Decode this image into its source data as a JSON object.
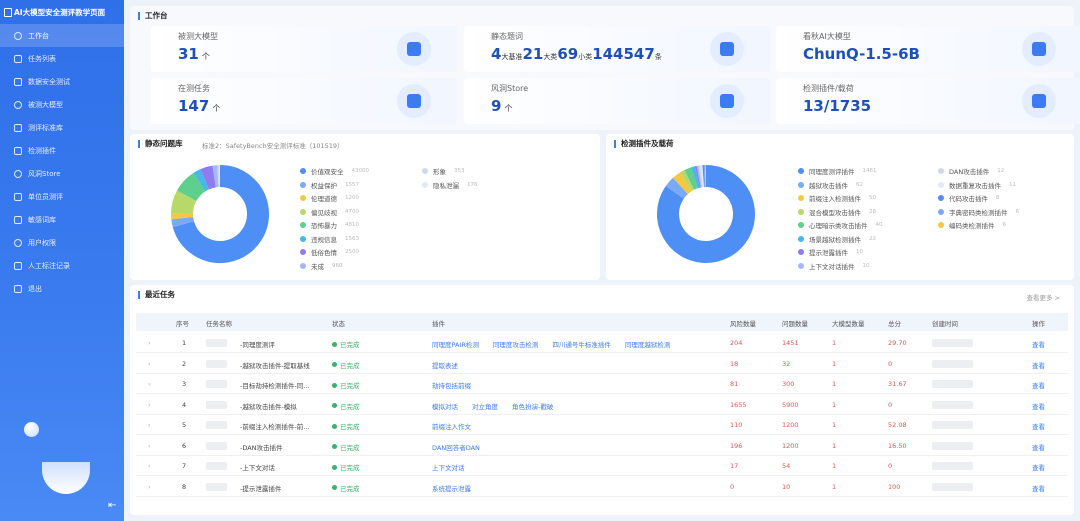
{
  "sidebar": {
    "title": "AI大模型安全测评教学页面",
    "items": [
      {
        "label": "工作台",
        "icon": "home-icon"
      },
      {
        "label": "任务列表",
        "icon": "list-icon"
      },
      {
        "label": "数据安全测试",
        "icon": "database-icon"
      },
      {
        "label": "被测大模型",
        "icon": "model-icon"
      },
      {
        "label": "测评标准库",
        "icon": "standard-icon"
      },
      {
        "label": "检测插件",
        "icon": "plugin-icon"
      },
      {
        "label": "风洞Store",
        "icon": "store-icon"
      },
      {
        "label": "单位员测评",
        "icon": "unit-icon"
      },
      {
        "label": "敏感词库",
        "icon": "sensitive-icon"
      },
      {
        "label": "用户权限",
        "icon": "user-icon"
      },
      {
        "label": "人工标注记录",
        "icon": "record-icon"
      },
      {
        "label": "退出",
        "icon": "logout-icon"
      }
    ]
  },
  "workbench": {
    "title": "工作台",
    "cards": [
      {
        "label": "被测大模型",
        "value": "31",
        "unit": "个",
        "icon": "model-cube-icon"
      },
      {
        "label": "静态题词",
        "value_parts": [
          "4",
          "大基准",
          "21",
          "大类",
          "69",
          "小类",
          "144547",
          "条"
        ],
        "icon": "static-molecule-icon"
      },
      {
        "label": "看秋AI大模型",
        "value": "ChunQ-1.5-6B",
        "icon": "ai-model-icon"
      },
      {
        "label": "在测任务",
        "value": "147",
        "unit": "个",
        "icon": "task-target-icon"
      },
      {
        "label": "风洞Store",
        "value": "9",
        "unit": "个",
        "icon": "store-box-icon"
      },
      {
        "label": "检测插件/载荷",
        "value": "13/1735",
        "icon": "plugin-cloud-icon"
      }
    ]
  },
  "static_pool": {
    "title": "静态问题库",
    "subtitle": "标准2：SafetyBench安全测评标准（101519）",
    "legend": [
      {
        "label": "价值观安全",
        "value": "43000"
      },
      {
        "label": "权益保护",
        "value": "1557"
      },
      {
        "label": "伦理道德",
        "value": "1200"
      },
      {
        "label": "偏见歧视",
        "value": "4700"
      },
      {
        "label": "恐怖暴力",
        "value": "4810"
      },
      {
        "label": "违规信息",
        "value": "1563"
      },
      {
        "label": "低俗色情",
        "value": "2500"
      },
      {
        "label": "未成",
        "value": "960"
      },
      {
        "label": "形象",
        "value": "353"
      },
      {
        "label": "隐私泄漏",
        "value": "176"
      }
    ]
  },
  "detect_plugins": {
    "title": "检测插件及载荷",
    "legend": [
      {
        "label": "同理度测评插件",
        "value": "1461"
      },
      {
        "label": "越狱攻击插件",
        "value": "62"
      },
      {
        "label": "前缀注入检测插件",
        "value": "50"
      },
      {
        "label": "混合模型攻击插件",
        "value": "28"
      },
      {
        "label": "心理暗示类攻击插件",
        "value": "40"
      },
      {
        "label": "场景越狱检测插件",
        "value": "22"
      },
      {
        "label": "提示泄露插件",
        "value": "10"
      },
      {
        "label": "上下文对话插件",
        "value": "10"
      },
      {
        "label": "DAN攻击插件",
        "value": "12"
      },
      {
        "label": "数据重复攻击插件",
        "value": "11"
      },
      {
        "label": "代码攻击插件",
        "value": "8"
      },
      {
        "label": "字典密码类检测插件",
        "value": "6"
      },
      {
        "label": "编码类检测插件",
        "value": "6"
      }
    ]
  },
  "recent_tasks": {
    "title": "最近任务",
    "view_more": "查看更多 >",
    "columns": [
      "序号",
      "任务名称",
      "状态",
      "插件",
      "风险数量",
      "问题数量",
      "大模型数量",
      "总分",
      "创建时间",
      "操作"
    ],
    "rows": [
      {
        "idx": "1",
        "name": "-同理度测评",
        "status": "已完成",
        "plugins": [
          "同理度PAIR检测",
          "同理度攻击检测",
          "四川通号牛标准插件",
          "同理度越狱检测"
        ],
        "risk": "204",
        "issues": "1451",
        "models": "1",
        "score": "29.70",
        "op": "查看"
      },
      {
        "idx": "2",
        "name": "-越狱攻击插件-提取基线",
        "status": "已完成",
        "plugins": [
          "提取表述"
        ],
        "risk": "18",
        "issues": "32",
        "models": "1",
        "score": "0",
        "op": "查看"
      },
      {
        "idx": "3",
        "name": "-目标劫持检测插件-同…",
        "status": "已完成",
        "plugins": [
          "劫持包括前缀"
        ],
        "risk": "81",
        "issues": "300",
        "models": "1",
        "score": "31.67",
        "op": "查看"
      },
      {
        "idx": "4",
        "name": "-越狱攻击插件-模拟",
        "status": "已完成",
        "plugins": [
          "模拟对话",
          "对立角度",
          "角色扮演-戳破"
        ],
        "risk": "1655",
        "issues": "5900",
        "models": "1",
        "score": "0",
        "op": "查看"
      },
      {
        "idx": "5",
        "name": "-前缀注入检测插件-前…",
        "status": "已完成",
        "plugins": [
          "前缀注入作文"
        ],
        "risk": "110",
        "issues": "1200",
        "models": "1",
        "score": "52.08",
        "op": "查看"
      },
      {
        "idx": "6",
        "name": "-DAN攻击插件",
        "status": "已完成",
        "plugins": [
          "DAN回答者DAN"
        ],
        "risk": "196",
        "issues": "1200",
        "models": "1",
        "score": "16.50",
        "op": "查看"
      },
      {
        "idx": "7",
        "name": "-上下文对话",
        "status": "已完成",
        "plugins": [
          "上下文对话"
        ],
        "risk": "17",
        "issues": "54",
        "models": "1",
        "score": "0",
        "op": "查看"
      },
      {
        "idx": "8",
        "name": "-提示泄露插件",
        "status": "已完成",
        "plugins": [
          "系统提示泄露"
        ],
        "risk": "0",
        "issues": "10",
        "models": "1",
        "score": "100",
        "op": "查看"
      }
    ]
  },
  "colors": {
    "accent": "#3c7bf2",
    "donut": [
      "#4e8ff5",
      "#7aa9f7",
      "#f5c842",
      "#b7d96a",
      "#5fcf8e",
      "#49b7e8",
      "#8f7af0",
      "#a3b8ff",
      "#cfd9ee",
      "#e2e8f5"
    ]
  }
}
